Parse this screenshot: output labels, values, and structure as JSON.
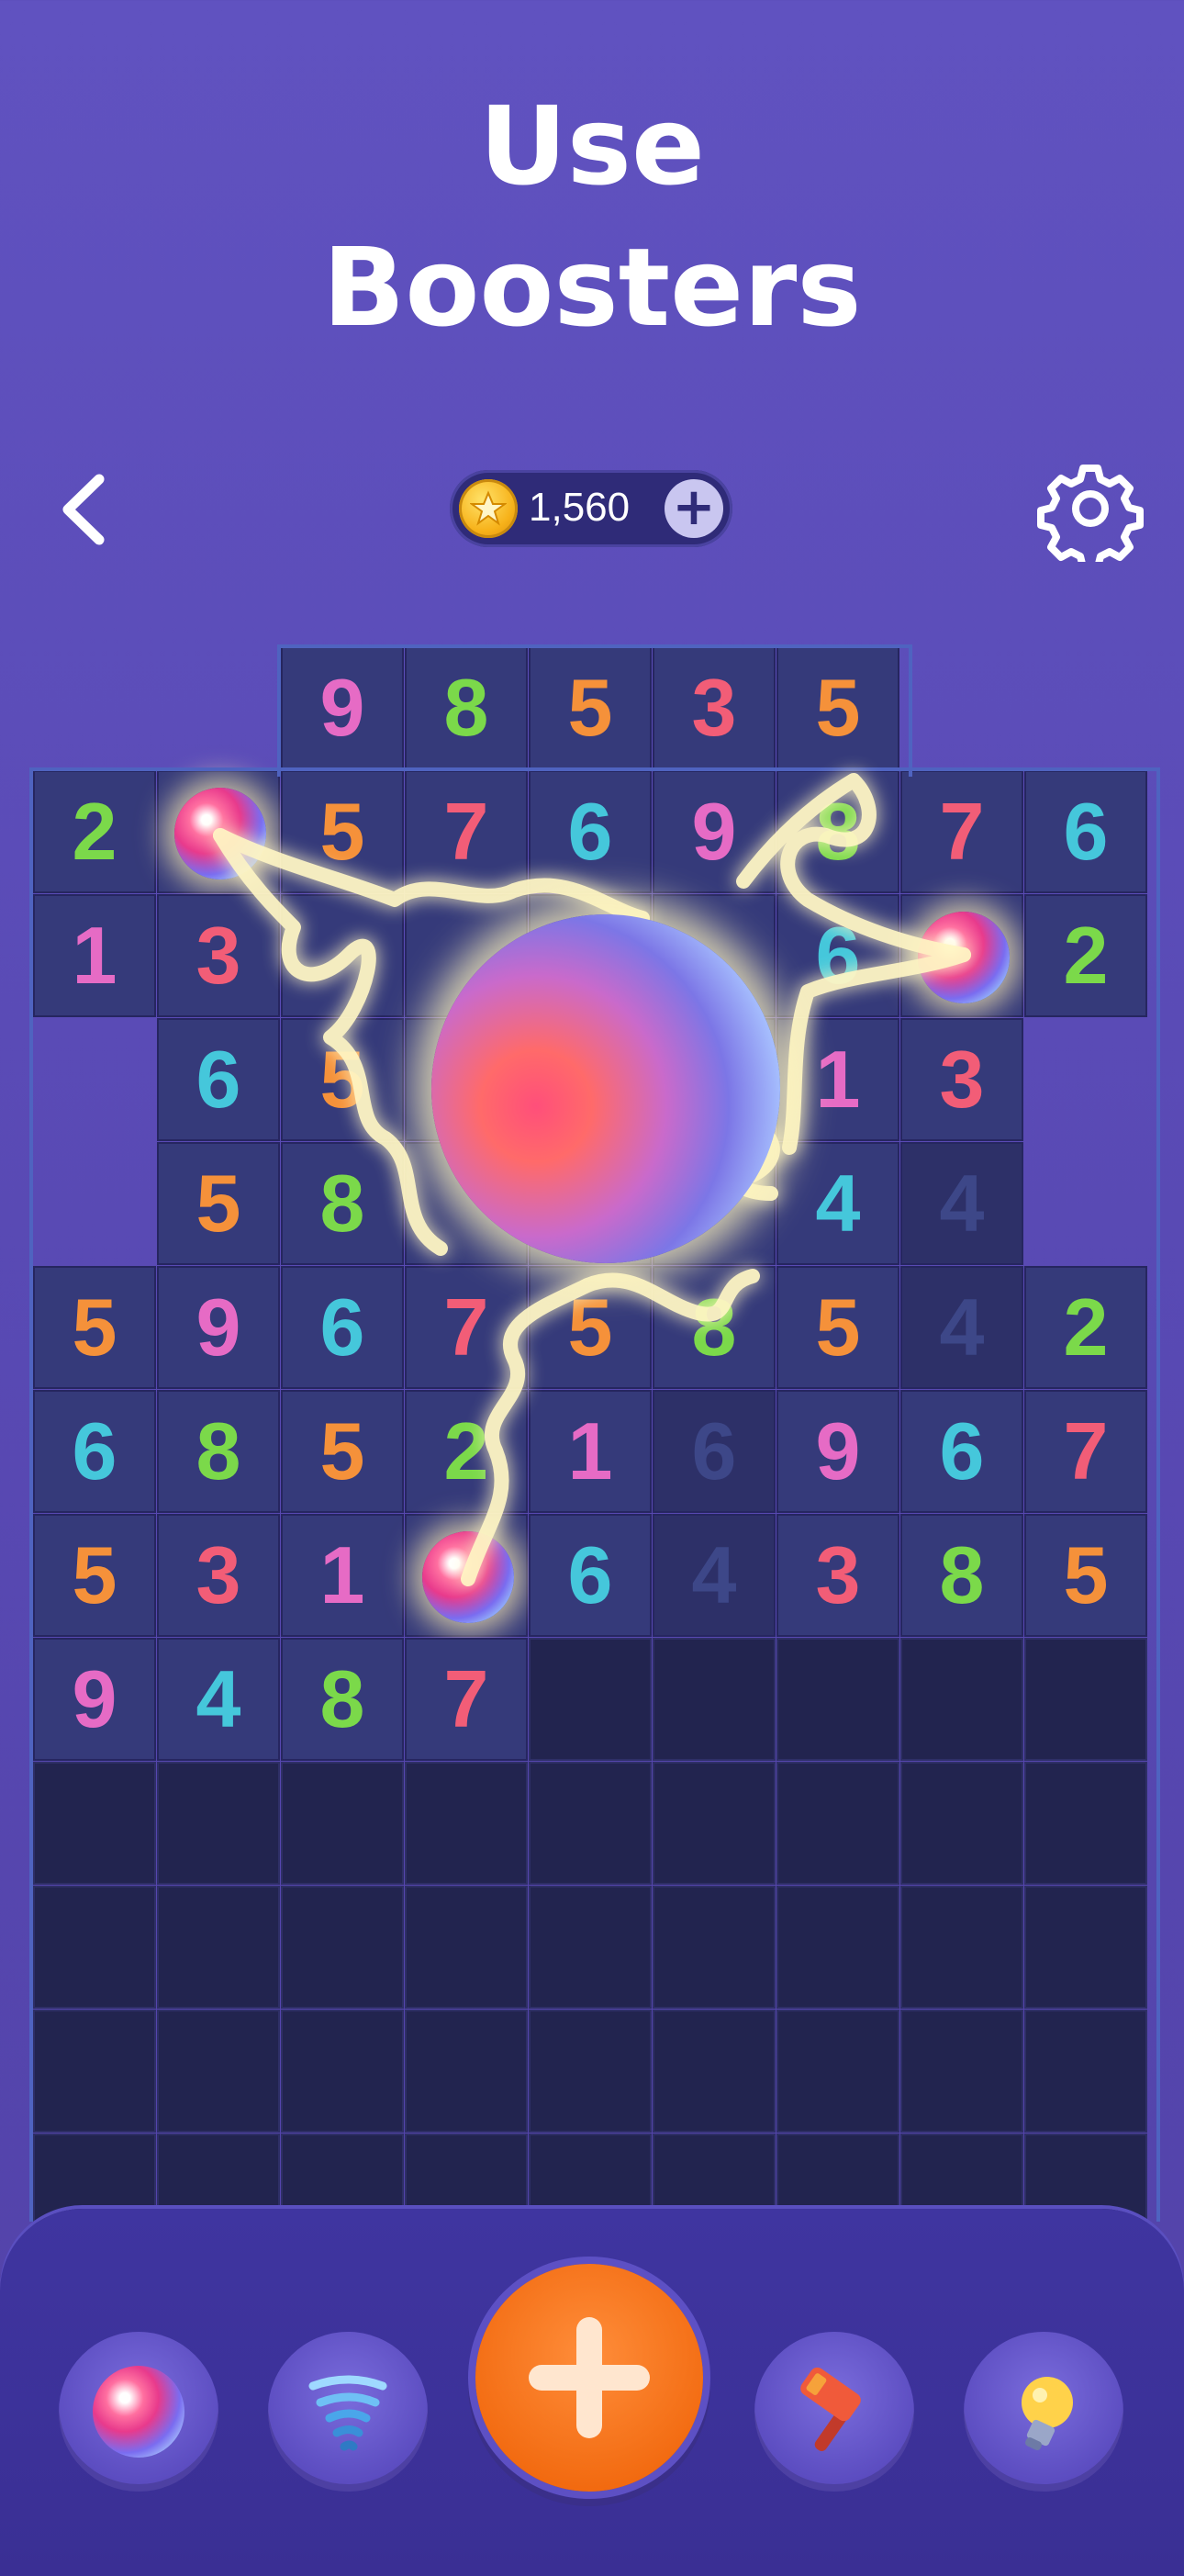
{
  "headline": {
    "line1": "Use",
    "line2": "Boosters"
  },
  "header": {
    "coins": "1,560"
  },
  "colors": {
    "1": "#e66bc5",
    "2": "#7bd94a",
    "3": "#f25d77",
    "4": "#45c7db",
    "5": "#f5913a",
    "6": "#45c7db",
    "7": "#f25d77",
    "8": "#7bd94a",
    "9": "#e66bc5"
  },
  "board": {
    "rows": [
      [
        null,
        null,
        "9",
        "8",
        "5",
        "3",
        "5",
        null,
        null
      ],
      [
        "2",
        "orb",
        "5",
        "7",
        "6",
        "9",
        "8",
        "7",
        "6"
      ],
      [
        "1",
        "3",
        "",
        "",
        "",
        "",
        "6",
        "orb",
        "2"
      ],
      [
        null,
        "6",
        "5",
        "",
        "",
        "",
        "1",
        "3",
        null
      ],
      [
        null,
        "5",
        "8",
        "",
        "",
        "",
        "4",
        "4d",
        null
      ],
      [
        "5",
        "9",
        "6",
        "7",
        "5",
        "8",
        "5",
        "4d",
        "2"
      ],
      [
        "6",
        "8",
        "5",
        "2",
        "1",
        "6d",
        "9",
        "6",
        "7"
      ],
      [
        "5",
        "3",
        "1",
        "orb",
        "6",
        "4d",
        "3",
        "8",
        "5"
      ],
      [
        "9",
        "4",
        "8",
        "7",
        "e",
        "e",
        "e",
        "e",
        "e"
      ],
      [
        "e",
        "e",
        "e",
        "e",
        "e",
        "e",
        "e",
        "e",
        "e"
      ],
      [
        "e",
        "e",
        "e",
        "e",
        "e",
        "e",
        "e",
        "e",
        "e"
      ],
      [
        "e",
        "e",
        "e",
        "e",
        "e",
        "e",
        "e",
        "e",
        "e"
      ],
      [
        "e",
        "e",
        "e",
        "e",
        "e",
        "e",
        "e",
        "e",
        "e"
      ]
    ]
  },
  "boosters": [
    {
      "name": "color-orb",
      "icon": "orb-icon"
    },
    {
      "name": "tornado",
      "icon": "tornado-icon"
    },
    {
      "name": "add",
      "icon": "plus-icon"
    },
    {
      "name": "hammer",
      "icon": "hammer-icon"
    },
    {
      "name": "hint",
      "icon": "lightbulb-icon"
    }
  ]
}
